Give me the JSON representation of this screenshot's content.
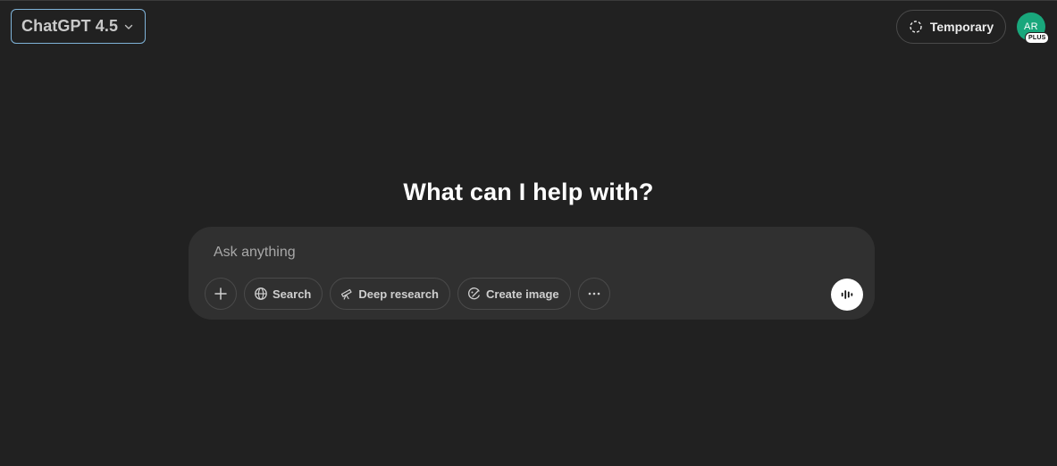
{
  "header": {
    "model_selector": {
      "label": "ChatGPT 4.5",
      "icon": "chevron-down-icon"
    },
    "temporary": {
      "label": "Temporary",
      "icon": "dashed-circle-icon"
    },
    "avatar": {
      "initials": "AR",
      "badge": "PLUS",
      "color": "#19a77c"
    }
  },
  "main": {
    "heading": "What can I help with?"
  },
  "composer": {
    "placeholder": "Ask anything",
    "value": "",
    "tools": [
      {
        "label": "",
        "icon": "plus-icon"
      },
      {
        "label": "Search",
        "icon": "globe-icon"
      },
      {
        "label": "Deep research",
        "icon": "telescope-icon"
      },
      {
        "label": "Create image",
        "icon": "image-brush-icon"
      },
      {
        "label": "",
        "icon": "more-horizontal-icon"
      }
    ],
    "voice": {
      "icon": "voice-waveform-icon"
    }
  },
  "colors": {
    "background": "#212121",
    "composer": "#303030",
    "selector_border": "#7fb3d8"
  }
}
